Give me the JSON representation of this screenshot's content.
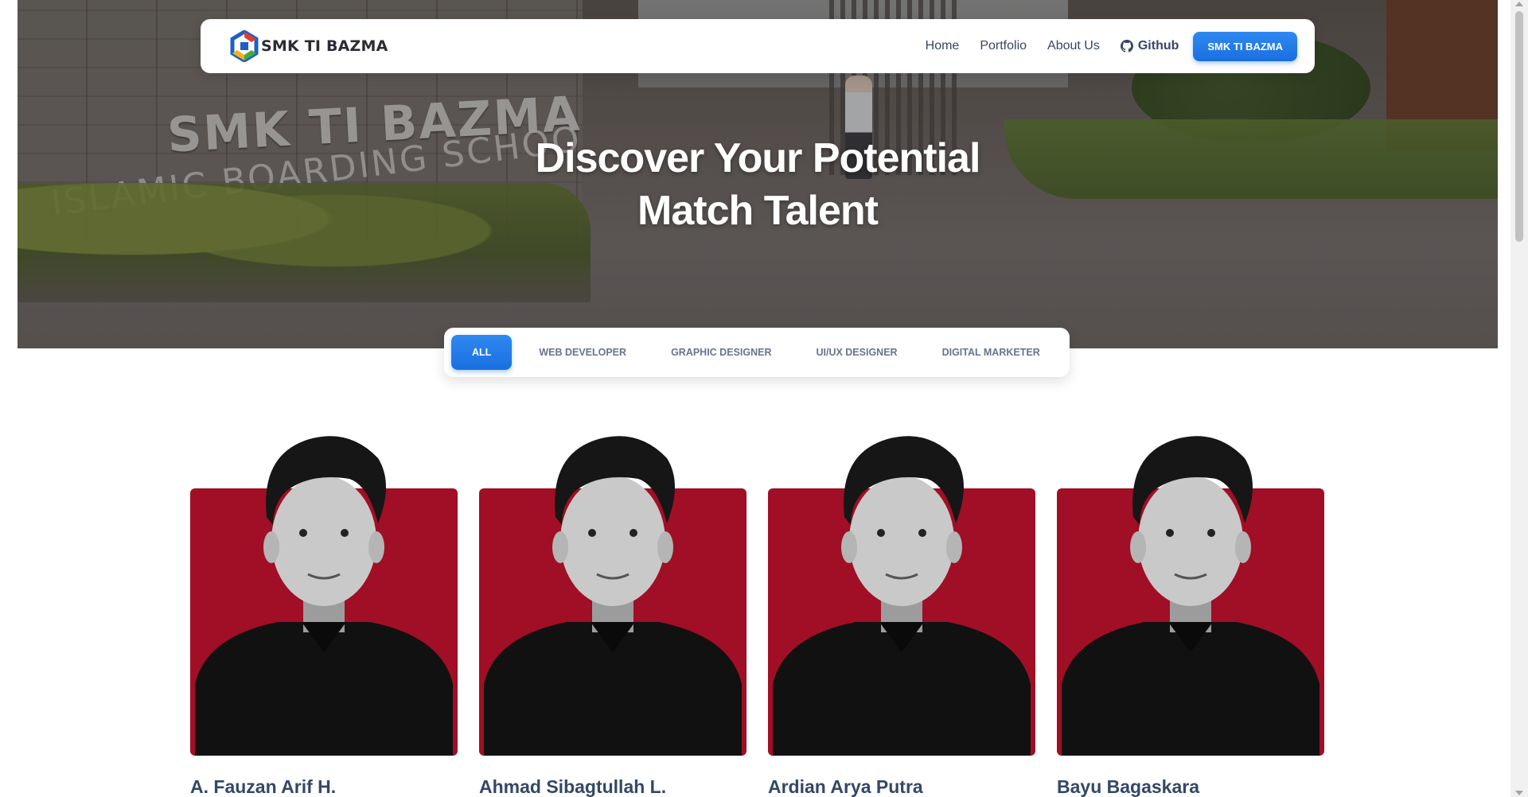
{
  "navbar": {
    "logo_text": "SMK TI BAZMA",
    "links": [
      "Home",
      "Portfolio",
      "About Us"
    ],
    "github_label": "Github",
    "cta_label": "SMK TI BAZMA"
  },
  "hero": {
    "title_line1": "Discover Your Potential",
    "title_line2": "Match Talent",
    "sign_line1": "SMK TI BAZMA",
    "sign_line2": "ISLAMIC BOARDING SCHOO"
  },
  "filters": {
    "tabs": [
      "ALL",
      "WEB DEVELOPER",
      "GRAPHIC DESIGNER",
      "UI/UX DESIGNER",
      "DIGITAL MARKETER"
    ],
    "active": "ALL"
  },
  "cards": [
    {
      "name": "A. Fauzan Arif H."
    },
    {
      "name": "Ahmad Sibagtullah L."
    },
    {
      "name": "Ardian Arya Putra"
    },
    {
      "name": "Bayu Bagaskara"
    }
  ],
  "colors": {
    "primary": "#1a6fe0",
    "card_bg": "#a00f25",
    "text_dark": "#344767",
    "text_muted": "#67748e"
  },
  "icons": {
    "github": "github-icon",
    "logo": "smk-logo-icon"
  }
}
